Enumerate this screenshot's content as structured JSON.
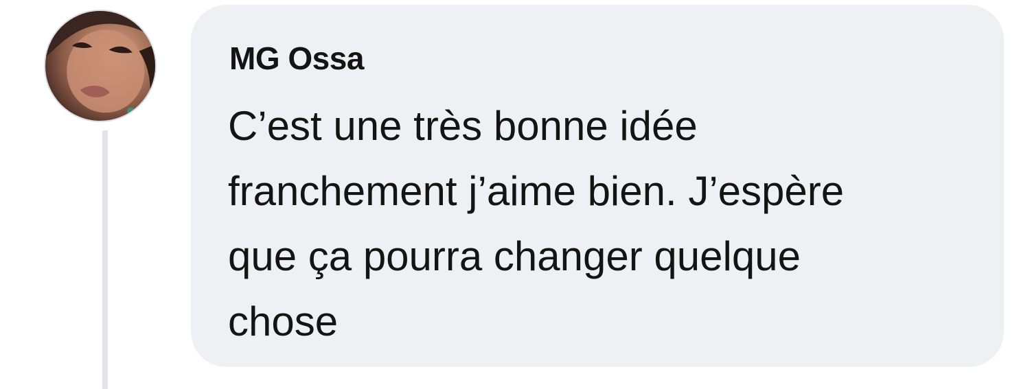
{
  "comment": {
    "author": "MG Ossa",
    "lines": [
      "C’est une très bonne idée",
      "franchement j’aime bien. J’espère",
      "que ça pourra changer quelque",
      "chose"
    ]
  },
  "icons": {
    "avatar": "profile-photo"
  },
  "colors": {
    "bubble": "#eff0f4",
    "thread_line": "#e1e4e9",
    "text": "#141414"
  }
}
